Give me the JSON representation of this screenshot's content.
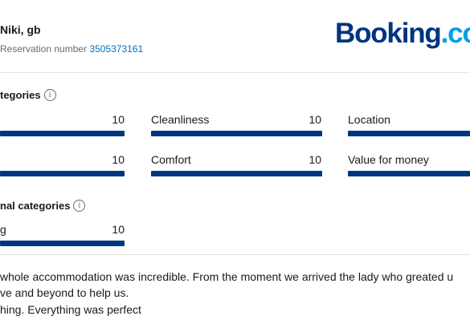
{
  "header": {
    "guest_name": "Niki, gb",
    "reservation_label": "Reservation number",
    "reservation_number": "3505373161",
    "logo_text_main": "Booking",
    "logo_text_suffix": ".co"
  },
  "categories": {
    "title": "tegories",
    "items": [
      {
        "label": "",
        "score": "10",
        "fraction": 1.0
      },
      {
        "label": "Cleanliness",
        "score": "10",
        "fraction": 1.0
      },
      {
        "label": "Location",
        "score": "",
        "fraction": 1.0
      },
      {
        "label": "",
        "score": "10",
        "fraction": 1.0
      },
      {
        "label": "Comfort",
        "score": "10",
        "fraction": 1.0
      },
      {
        "label": "Value for money",
        "score": "",
        "fraction": 1.0
      }
    ]
  },
  "additional_categories": {
    "title": "nal categories",
    "items": [
      {
        "label": "g",
        "score": "10",
        "fraction": 1.0
      }
    ]
  },
  "review": {
    "line1": "whole accommodation was incredible. From the moment we arrived the lady who greated u",
    "line2": "ve and beyond to help us.",
    "line3": "hing. Everything was perfect"
  },
  "colors": {
    "brand": "#003580",
    "link": "#0071c2"
  }
}
